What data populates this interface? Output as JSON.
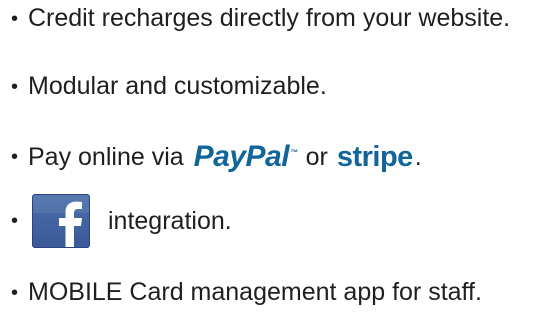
{
  "bullet": "•",
  "features": [
    {
      "text": "Credit recharges directly from your website."
    },
    {
      "text": "Modular and customizable."
    },
    {
      "prefix": "Pay online via",
      "paypal_logo": "PayPal",
      "paypal_tm": "™",
      "middle": "or",
      "stripe_logo": "stripe",
      "suffix": "."
    },
    {
      "fb_logo_icon": "facebook-logo-icon",
      "text": "integration."
    },
    {
      "text": "MOBILE Card management app for staff."
    }
  ],
  "colors": {
    "text": "#1f1f1f",
    "brand_blue": "#12659a",
    "facebook_blue": "#3b5998"
  }
}
